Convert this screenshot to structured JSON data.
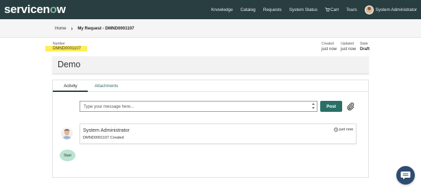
{
  "brand": {
    "logo_text_prefix": "servicen",
    "logo_text_o": "o",
    "logo_text_suffix": "w"
  },
  "nav": {
    "knowledge": "Knowledge",
    "catalog": "Catalog",
    "requests": "Requests",
    "system_status": "System Status",
    "cart": "Cart",
    "tours": "Tours",
    "user": "System Administrator"
  },
  "breadcrumb": {
    "home": "Home",
    "current": "My Request - DMND0001107"
  },
  "record": {
    "number_label": "Number",
    "number_value": "DMND0001107",
    "created_label": "Created",
    "created_value": "just now",
    "updated_label": "Updated",
    "updated_value": "just now",
    "state_label": "State",
    "state_value": "Draft"
  },
  "title": "Demo",
  "tabs": {
    "activity": "Activity",
    "attachments": "Attachments"
  },
  "composer": {
    "placeholder": "Type your message here...",
    "post_label": "Post"
  },
  "activity": {
    "author": "System Administrator",
    "time": "just now",
    "text": "DMND0001107 Created",
    "start_label": "Start"
  },
  "colors": {
    "nav_bg": "#293e40",
    "post_bg": "#2a6f66",
    "highlight": "#ffee58",
    "start_badge": "#b9e4d0",
    "chat_bg": "#2d4c6f"
  },
  "icons": [
    "cart-icon",
    "avatar",
    "chevron-right-icon",
    "paperclip-icon",
    "clock-icon",
    "chat-icon"
  ]
}
